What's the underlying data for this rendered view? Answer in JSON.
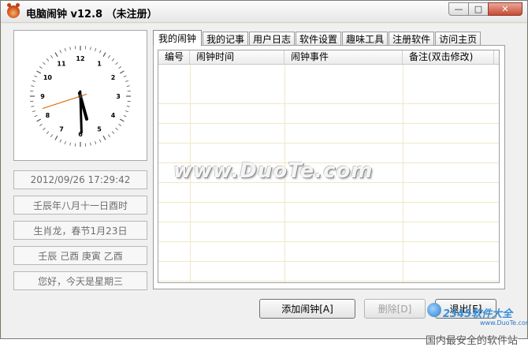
{
  "window": {
    "title": "电脑闹钟 v12.8 （未注册）",
    "controls": {
      "minimize": "—",
      "maximize": "□",
      "close": "✕"
    }
  },
  "clock": {
    "numbers": [
      "12",
      "1",
      "2",
      "3",
      "4",
      "5",
      "6",
      "7",
      "8",
      "9",
      "10",
      "11"
    ],
    "time": {
      "hour": 17,
      "minute": 29,
      "second": 42
    }
  },
  "info_panel": [
    "2012/09/26 17:29:42",
    "壬辰年八月十一日酉时",
    "生肖龙，春节1月23日",
    "壬辰 己酉 庚寅 乙酉",
    "您好，今天是星期三"
  ],
  "tabs": [
    "我的闹钟",
    "我的记事",
    "用户日志",
    "软件设置",
    "趣味工具",
    "注册软件",
    "访问主页"
  ],
  "active_tab": 0,
  "table": {
    "columns": [
      "编号",
      "闹钟时间",
      "闹钟事件",
      "备注(双击修改)"
    ],
    "rows": []
  },
  "buttons": {
    "add": "添加闹钟[A]",
    "delete": "删除[D]",
    "exit": "退出[E]"
  },
  "watermarks": {
    "center": "www.DuoTe.com",
    "site": "2345软件大全",
    "site_url": "www.DuoTe.com",
    "slogan": "国内最安全的软件站"
  },
  "colors": {
    "hour_hand": "#000000",
    "second_hand": "#e07010",
    "grid_line": "#eee8c4"
  }
}
